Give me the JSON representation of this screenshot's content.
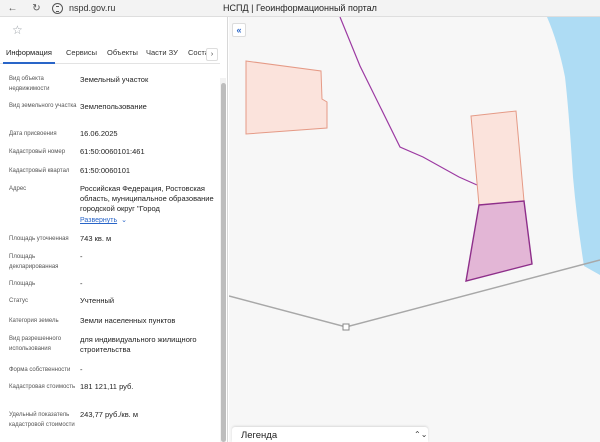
{
  "browser": {
    "url": "nspd.gov.ru",
    "title": "НСПД | Геоинформационный портал",
    "back_icon": "←",
    "reload_icon": "↻",
    "site_icon": "site-info-icon"
  },
  "panel": {
    "star_icon": "☆",
    "tabs": [
      {
        "label": "Информация",
        "active": true
      },
      {
        "label": "Сервисы"
      },
      {
        "label": "Объекты"
      },
      {
        "label": "Части ЗУ"
      },
      {
        "label": "Соста"
      }
    ],
    "tabs_next_icon": "›",
    "rows": [
      {
        "label": "Вид объекта недвижимости",
        "value": "Земельный участок"
      },
      {
        "label": "Вид земельного участка",
        "value": "Землепользование"
      },
      {
        "label": "Дата присвоения",
        "value": "16.06.2025"
      },
      {
        "label": "Кадастровый номер",
        "value": "61:50:0060101:461"
      },
      {
        "label": "Кадастровый квартал",
        "value": "61:50:0060101"
      },
      {
        "label": "Адрес",
        "value": "Российская Федерация, Ростовская область, муниципальное образование городской округ \"Город",
        "expand": "Развернуть",
        "expand_icon": "⌄"
      },
      {
        "label": "Площадь уточненная",
        "value": "743 кв. м"
      },
      {
        "label": "Площадь декларированная",
        "value": "-"
      },
      {
        "label": "Площадь",
        "value": "-"
      },
      {
        "label": "Статус",
        "value": "Учтенный"
      },
      {
        "label": "Категория земель",
        "value": "Земли населенных пунктов"
      },
      {
        "label": "Вид разрешенного использования",
        "value": "для индивидуального жилищного строительства"
      },
      {
        "label": "Форма собственности",
        "value": "-"
      },
      {
        "label": "Кадастровая стоимость",
        "value": "181 121,11 руб."
      },
      {
        "label": "Удельный показатель кадастровой стоимости",
        "value": "243,77 руб./кв. м"
      }
    ]
  },
  "map": {
    "collapse_icon": "«",
    "legend_title": "Легенда",
    "legend_icon": "⌃⌄",
    "colors": {
      "background": "#f7f7f7",
      "water": "#aedcf4",
      "parcel_fill": "#fbe3dc",
      "parcel_stroke": "#e59a86",
      "selected_fill": "#e3b6d6",
      "selected_stroke": "#8e2f8a",
      "boundary": "#9c3aa2",
      "road": "#a8a8a8"
    }
  }
}
